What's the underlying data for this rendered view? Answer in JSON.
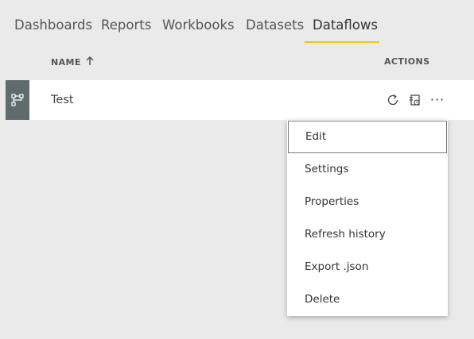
{
  "tabs": [
    {
      "label": "Dashboards",
      "active": false
    },
    {
      "label": "Reports",
      "active": false
    },
    {
      "label": "Workbooks",
      "active": false
    },
    {
      "label": "Datasets",
      "active": false
    },
    {
      "label": "Dataflows",
      "active": true
    }
  ],
  "table": {
    "columns": {
      "name": "NAME",
      "actions": "ACTIONS"
    },
    "sort": "ascending",
    "rows": [
      {
        "name": "Test",
        "icon": "dataflow-icon"
      }
    ]
  },
  "row_actions": {
    "icons": [
      "refresh-icon",
      "schedule-refresh-icon",
      "more-options-icon"
    ],
    "more_glyph": "···"
  },
  "context_menu": {
    "items": [
      {
        "label": "Edit",
        "focused": true
      },
      {
        "label": "Settings"
      },
      {
        "label": "Properties"
      },
      {
        "label": "Refresh history"
      },
      {
        "label": "Export .json"
      },
      {
        "label": "Delete"
      }
    ]
  },
  "colors": {
    "background": "#eaeaea",
    "accent_underline": "#f2c811",
    "row_icon_bg": "#5f6b6d",
    "row_bg": "#ffffff"
  }
}
